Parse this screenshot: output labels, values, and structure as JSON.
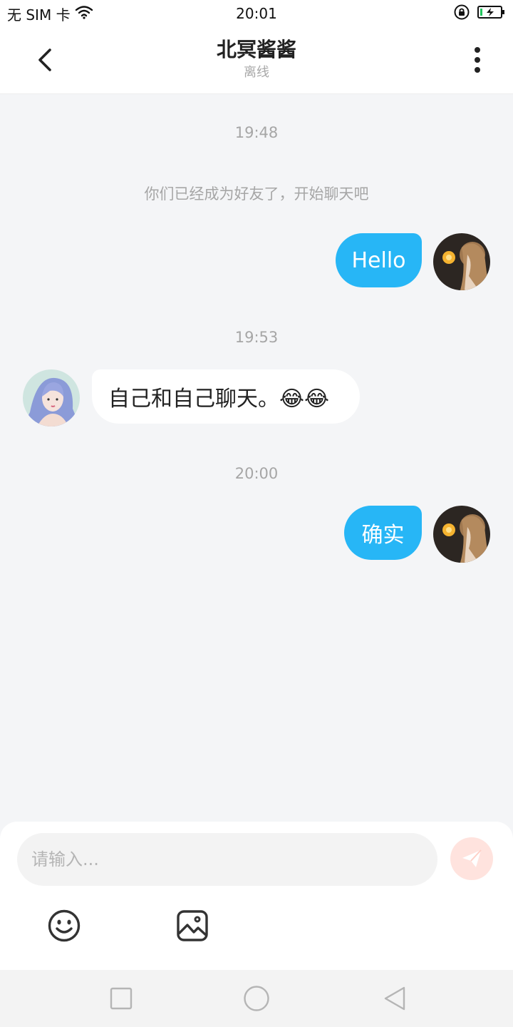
{
  "status_bar": {
    "carrier": "无 SIM 卡",
    "time": "20:01"
  },
  "header": {
    "title": "北冥酱酱",
    "subtitle": "离线"
  },
  "messages": [
    {
      "type": "timestamp",
      "text": "19:48"
    },
    {
      "type": "system",
      "text": "你们已经成为好友了，开始聊天吧"
    },
    {
      "type": "sent",
      "text": "Hello"
    },
    {
      "type": "timestamp",
      "text": "19:53"
    },
    {
      "type": "received",
      "text": "自己和自己聊天。😂😂"
    },
    {
      "type": "timestamp",
      "text": "20:00"
    },
    {
      "type": "sent",
      "text": "确实"
    }
  ],
  "composer": {
    "placeholder": "请输入..."
  },
  "icons": {
    "back": "back-chevron-icon",
    "more": "more-vertical-icon",
    "send": "paper-plane-icon",
    "emoji": "smiley-icon",
    "image": "image-icon",
    "wifi": "wifi-icon",
    "rotation_lock": "rotation-lock-icon",
    "battery": "battery-charging-icon"
  },
  "colors": {
    "sent_bubble": "#27b6f6",
    "received_bubble": "#ffffff",
    "background": "#f4f5f7",
    "send_button": "#ffe3de"
  }
}
